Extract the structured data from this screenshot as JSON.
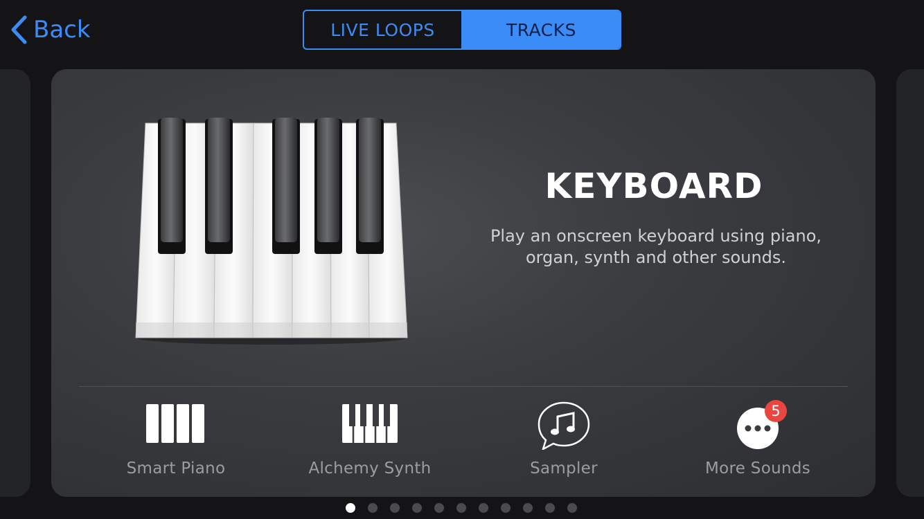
{
  "nav": {
    "back_label": "Back"
  },
  "segments": {
    "live_loops": "LIVE LOOPS",
    "tracks": "TRACKS",
    "selected": "TRACKS"
  },
  "card": {
    "title": "KEYBOARD",
    "description": "Play an onscreen keyboard using piano, organ, synth and other sounds.",
    "instruments": [
      {
        "label": "Smart Piano",
        "icon": "smart-piano-icon"
      },
      {
        "label": "Alchemy Synth",
        "icon": "keyboard-keys-icon"
      },
      {
        "label": "Sampler",
        "icon": "music-note-speech-bubble-icon"
      },
      {
        "label": "More Sounds",
        "icon": "more-ellipsis-icon",
        "badge": "5"
      }
    ]
  },
  "pagination": {
    "total": 11,
    "current": 1
  },
  "colors": {
    "accent": "#3b8cf7",
    "badge": "#e9463f",
    "background": "#141417"
  }
}
